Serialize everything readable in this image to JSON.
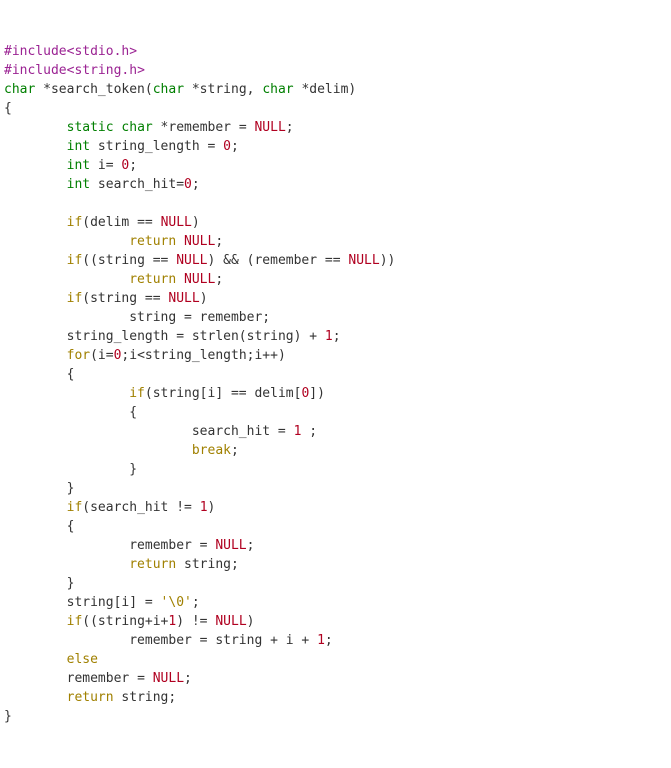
{
  "code": {
    "l01_inc": "#include",
    "l01_hdr": "<stdio.h>",
    "l02_inc": "#include",
    "l02_hdr": "<string.h>",
    "l03_char": "char",
    "l03_a": " *search_token(",
    "l03_b": " *string, ",
    "l03_c": " *delim)",
    "l04": "{",
    "l05_ind": "        ",
    "l05_static": "static",
    "l05_sp": " ",
    "l05_char": "char",
    "l05_rest": " *remember = ",
    "l05_null": "NULL",
    "l05_semi": ";",
    "l06_int": "int",
    "l06_rest": " string_length = ",
    "l06_zero": "0",
    "l07_int": "int",
    "l07_rest": " i= ",
    "l08_int": "int",
    "l08_rest": " search_hit=",
    "blankind": "",
    "l10_if": "if",
    "l10_rest": "(delim == ",
    "l10_null": "NULL",
    "l10_close": ")",
    "l11_ind": "                ",
    "l11_ret": "return",
    "l11_sp": " ",
    "l12_if": "if",
    "l12_a": "((string == ",
    "l12_b": ") && (remember == ",
    "l12_c": "))",
    "l14_if": "if",
    "l14_a": "(string == ",
    "l14_b": ")",
    "l15_txt": "string = remember;",
    "l16_txt": "string_length = strlen(string) + ",
    "l16_one": "1",
    "l17_for": "for",
    "l17_a": "(i=",
    "l17_b": ";i<string_length;i++)",
    "l18": "{",
    "l19_if": "if",
    "l19_a": "(string[i] == delim[",
    "l19_b": "])",
    "l20": "{",
    "l21_ind": "                        ",
    "l21_a": "search_hit = ",
    "l21_b": " ;",
    "l22_break": "break",
    "l23": "}",
    "l24": "}",
    "l25_if": "if",
    "l25_a": "(search_hit != ",
    "l25_b": ")",
    "l26": "{",
    "l27_a": "remember = ",
    "l28_ret": "return",
    "l28_a": " string;",
    "l29": "}",
    "l30_a": "string[i] = ",
    "l30_ch": "'\\0'",
    "l31_if": "if",
    "l31_a": "((string+i+",
    "l31_b": ") != ",
    "l31_c": ")",
    "l32_a": "remember = string + i + ",
    "l33_else": "else",
    "l34_a": "remember = ",
    "l35_ret": "return",
    "l35_a": " string;",
    "l36": "}"
  }
}
